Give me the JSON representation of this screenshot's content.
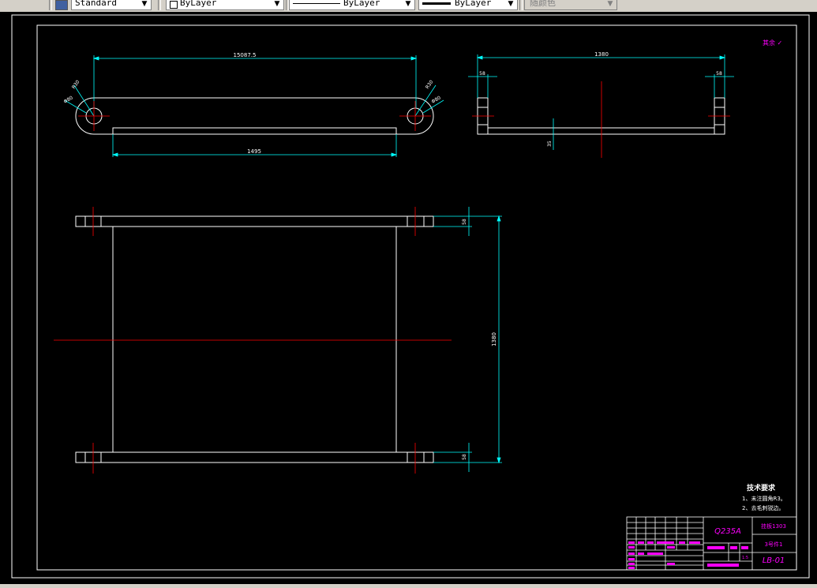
{
  "toolbar": {
    "text_style": "Standard",
    "layer": "ByLayer",
    "linetype": "ByLayer",
    "lineweight": "ByLayer",
    "plot_style": "随颜色"
  },
  "drawing": {
    "corner_mark": "其余 ✓",
    "top_view": {
      "overall_length": "15087.5",
      "inner_length": "1495",
      "radius": "R30",
      "hole_dia": "Φ80"
    },
    "side_view": {
      "width": "1380",
      "flange_left": "58",
      "flange_right": "58",
      "thickness": "35"
    },
    "front_view": {
      "top_flange": "58",
      "bottom_flange": "58",
      "height": "1380"
    },
    "tech_req": {
      "title": "技术要求",
      "items": [
        "1、未注圆角R3。",
        "2、去毛刺锐边。"
      ]
    },
    "title_block": {
      "material": "Q235A",
      "part_name": "挂板1303",
      "part_sub": "3号件1",
      "drawing_no": "LB-01",
      "scale": "1:5"
    }
  },
  "colors": {
    "geometry": "#ffffff",
    "dimension": "#00ffff",
    "centerline": "#ff0000",
    "annotation": "#ff00ff"
  }
}
